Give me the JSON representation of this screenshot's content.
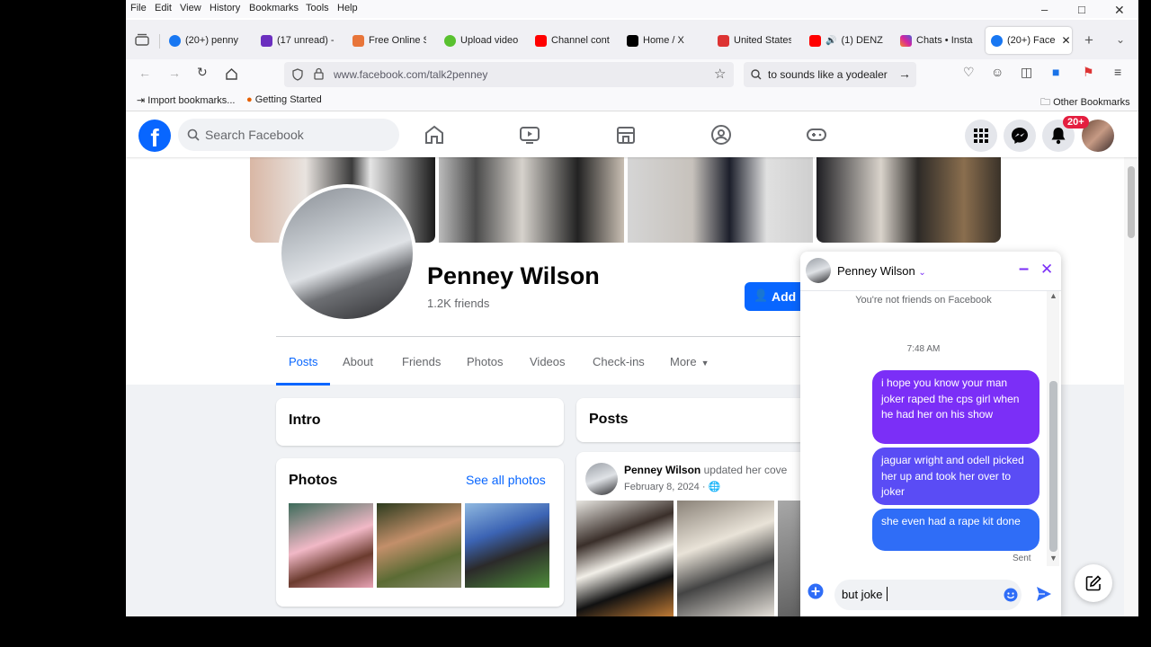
{
  "menubar": {
    "items": [
      "File",
      "Edit",
      "View",
      "History",
      "Bookmarks",
      "Tools",
      "Help"
    ]
  },
  "tabs": [
    {
      "label": "(20+) penny",
      "favicon": "facebook-icon",
      "color": "#1877f2"
    },
    {
      "label": "(17 unread) -",
      "favicon": "mail-icon",
      "color": "#6b2fbf"
    },
    {
      "label": "Free Online S",
      "favicon": "app-icon",
      "color": "#e8753a"
    },
    {
      "label": "Upload video",
      "favicon": "upload-icon",
      "color": "#59c12f"
    },
    {
      "label": "Channel cont",
      "favicon": "youtube-icon",
      "color": "#ff0000"
    },
    {
      "label": "Home / X",
      "favicon": "x-icon",
      "color": "#000000"
    },
    {
      "label": "United States",
      "favicon": "doc-icon",
      "color": "#d33"
    },
    {
      "label": "(1) DENZ",
      "favicon": "youtube-icon",
      "color": "#ff0000"
    },
    {
      "label": "Chats • Insta",
      "favicon": "instagram-icon",
      "color": "#d6249f"
    },
    {
      "label": "(20+) Face",
      "favicon": "facebook-icon",
      "color": "#1877f2"
    }
  ],
  "navbar": {
    "url": "www.facebook.com/talk2penney",
    "search": "to  sounds like a yodealer"
  },
  "bookmarks": {
    "import": "Import bookmarks...",
    "getting_started": "Getting Started",
    "other": "Other Bookmarks"
  },
  "fb": {
    "search_placeholder": "Search Facebook",
    "notification_count": "20+"
  },
  "profile": {
    "name": "Penney Wilson",
    "friends": "1.2K friends",
    "add_button": "Add",
    "tabs": [
      "Posts",
      "About",
      "Friends",
      "Photos",
      "Videos",
      "Check-ins",
      "More"
    ],
    "active_tab": "Posts"
  },
  "intro": {
    "title": "Intro"
  },
  "photos": {
    "title": "Photos",
    "see_all": "See all photos"
  },
  "posts": {
    "title": "Posts",
    "author": "Penney Wilson",
    "action": "updated her cove",
    "date": "February 8, 2024 ·"
  },
  "chat": {
    "name": "Penney Wilson",
    "not_friends": "You're not friends on Facebook",
    "time": "7:48 AM",
    "messages": [
      "i hope you know your man joker raped the cps girl when he had her on his show",
      "jaguar wright and odell picked her up and took her over to joker",
      "she even had a rape kit done"
    ],
    "status": "Sent",
    "draft": "but joke",
    "accent": "#7b2ff7"
  }
}
